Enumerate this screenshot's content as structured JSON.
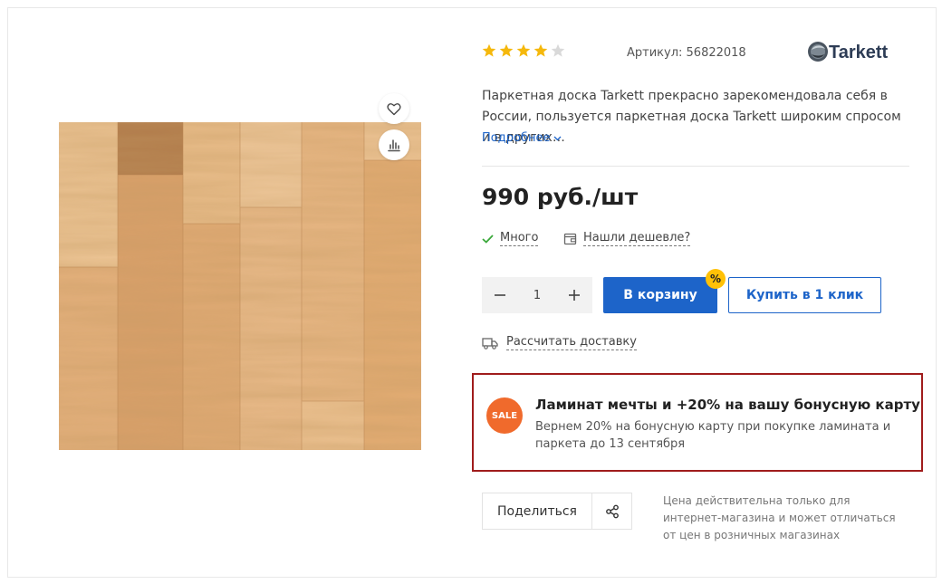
{
  "product": {
    "rating": 4,
    "rating_max": 5,
    "sku_text": "Артикул: 56822018",
    "brand_logo_text": "Tarkett",
    "description": "Паркетная доска Tarkett прекрасно зарекомендовала себя в России, пользуется паркетная доска Tarkett широким спросом и в других…",
    "more_label": "Подробнее",
    "price": "990 руб./шт",
    "stock_label": "Много",
    "cheaper_label": "Нашли дешевле?"
  },
  "purchase": {
    "quantity": "1",
    "cart_label": "В корзину",
    "badge_label": "%",
    "one_click_label": "Купить в 1 клик",
    "delivery_label": "Рассчитать доставку"
  },
  "promo": {
    "badge": "SALE",
    "title": "Ламинат мечты и +20% на вашу бонусную карту",
    "text": "Вернем 20% на бонусную карту при покупке ламината и паркета до 13 сентября"
  },
  "share": {
    "label": "Поделиться"
  },
  "note": "Цена действительна только для интернет-магазина и может отличаться от цен в розничных магазинах",
  "colors": {
    "accent": "#1d64c9",
    "star_filled": "#f5b80c",
    "star_empty": "#d9d9d9",
    "promo_border": "#a01c1c",
    "sale_badge": "#f06a2c",
    "percent_badge": "#ffc107"
  },
  "icons": {
    "favorite": "heart-icon",
    "compare": "chart-bars-icon",
    "stock": "check-icon",
    "cheaper": "wallet-icon",
    "delivery": "truck-icon",
    "share": "share-icon",
    "more": "chevron-down-icon"
  }
}
